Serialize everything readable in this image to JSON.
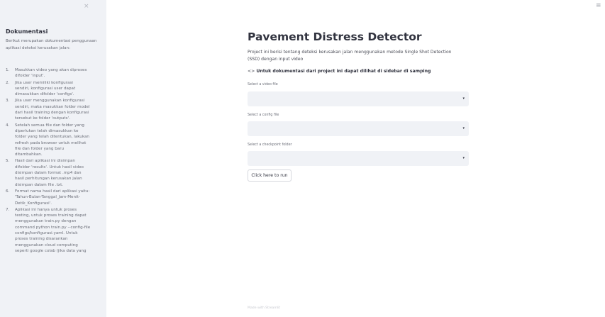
{
  "sidebar": {
    "close_icon": "×",
    "title": "Dokumentasi",
    "intro": "Berikut merupakan dokumentasi penggunaan aplikasi deteksi kerusakan jalan:",
    "items": [
      {
        "num": "1.",
        "text": "Masukkan video yang akan diproses\ndifolder 'input'."
      },
      {
        "num": "2.",
        "text": "Jika user memiliki konfigurasi\nsendiri, konfigurasi user dapat\ndimasukkan difolder 'configs'."
      },
      {
        "num": "3.",
        "text": "Jika user menggunakan konfigurasi\nsendiri, maka masukkan folder model\ndari hasil training dengan konfigurasi\ntersebut ke folder 'outputs'."
      },
      {
        "num": "4.",
        "text": "Setelah semua file dan folder yang\ndiperlukan telah dimasukkan ke\nfolder yang telah ditentukan, lakukan\nrefresh pada browser untuk melihat\nfile dan folder yang baru\nditambahkan."
      },
      {
        "num": "5.",
        "text": "Hasil dari aplikasi ini disimpan\ndifolder 'results'. Untuk hasil video\ndisimpan dalam format .mp4 dan\nhasil perhitungan kerusakan jalan\ndisimpan dalam file .txt."
      },
      {
        "num": "6.",
        "text": "Format nama hasil dari aplikasi yaitu:\n'Tahun-Bulan-Tanggal_Jam-Menit-\nDetik_Konfigurasi'."
      },
      {
        "num": "7.",
        "text": "Aplikasi ini hanya untuk proses\ntesting, untuk proses training dapat\nmenggunakan train.py dengan\ncommand python train.py --config-file\nconfigs/konfigurasi.yaml. Untuk\nproses training disarankan\nmenggunakan cloud computing\nseperti google colab (jika data yang"
      }
    ]
  },
  "header": {
    "menu_icon": "≡"
  },
  "main": {
    "title": "Pavement Distress Detector",
    "description": "Project ini berisi tentang deteksi kerusakan jalan menggunakan metode Single Shot Detection\n(SSD) dengan input video",
    "note_icon": "<>",
    "note": "Untuk dokumentasi dari project ini dapat dilihat di sidebar di samping",
    "video_label": "Select a video file",
    "video_value": "",
    "config_label": "Select a config file",
    "config_value": "",
    "checkpoint_label": "Select a checkpoint folder",
    "checkpoint_value": "",
    "run_label": "Click here to run"
  },
  "footer": {
    "text": "Made with Streamlit"
  },
  "colors": {
    "sidebar_bg": "#f0f2f6",
    "select_bg": "#f0f2f6",
    "text": "#31333f"
  }
}
